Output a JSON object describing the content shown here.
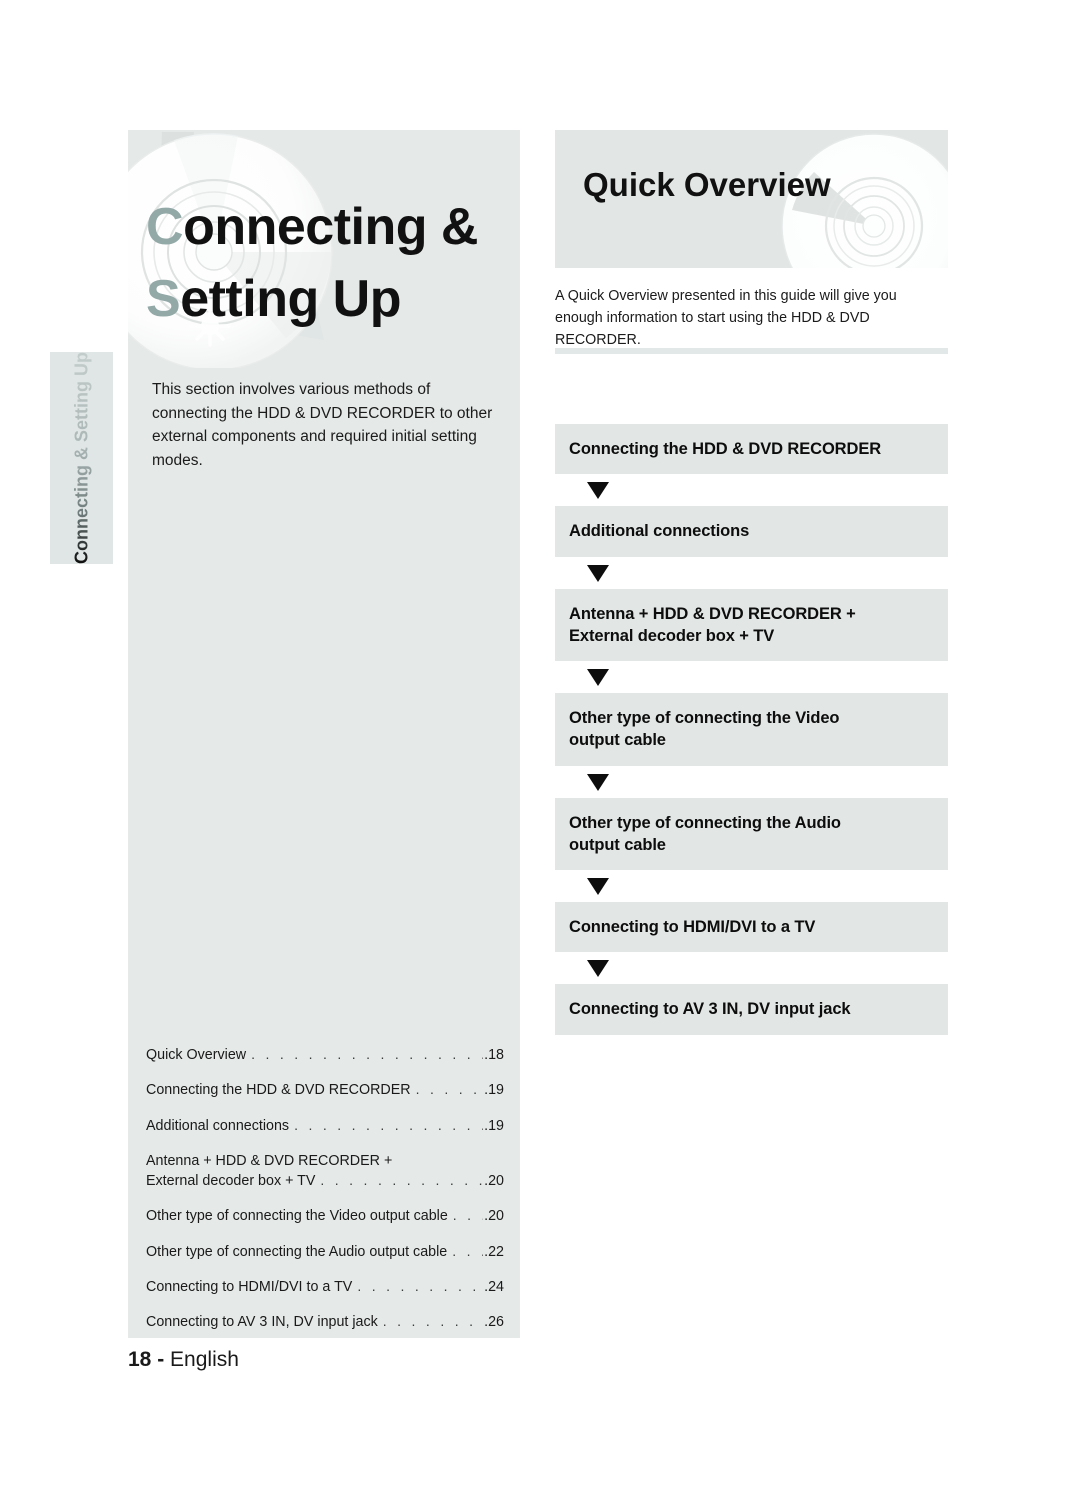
{
  "section": {
    "title_accent_1": "C",
    "title_rest_1": "onnecting &",
    "title_accent_2": "S",
    "title_rest_2": "etting Up",
    "side_tab_label": "Connecting & Setting Up",
    "intro_paragraph": "This section involves various methods of connecting the HDD & DVD RECORDER to other external components and required initial setting modes."
  },
  "quick_overview": {
    "heading": "Quick Overview",
    "paragraph": "A Quick Overview presented in this guide will give you enough information to start using the HDD & DVD RECORDER."
  },
  "flow": {
    "steps": [
      {
        "label": "Connecting the HDD & DVD RECORDER"
      },
      {
        "label": "Additional connections"
      },
      {
        "label": "Antenna + HDD & DVD RECORDER +\nExternal decoder box + TV"
      },
      {
        "label": "Other type of connecting the Video\noutput cable"
      },
      {
        "label": "Other type of connecting the Audio\noutput cable"
      },
      {
        "label": "Connecting to HDMI/DVI to a TV"
      },
      {
        "label": "Connecting to AV 3 IN, DV input jack"
      }
    ]
  },
  "toc": {
    "entries": [
      {
        "label": "Quick Overview",
        "page": "18",
        "wrap": null
      },
      {
        "label": "Connecting the HDD & DVD RECORDER",
        "page": "19",
        "wrap": null
      },
      {
        "label": "Additional connections",
        "page": "19",
        "wrap": null
      },
      {
        "label": "External decoder box + TV",
        "page": "20",
        "wrap": "Antenna + HDD & DVD RECORDER +"
      },
      {
        "label": "Other type of connecting the Video output cable",
        "page": "20",
        "wrap": null
      },
      {
        "label": "Other type of connecting the Audio output cable",
        "page": "22",
        "wrap": null
      },
      {
        "label": "Connecting to HDMI/DVI to a TV",
        "page": "24",
        "wrap": null
      },
      {
        "label": "Connecting to AV 3 IN, DV input jack",
        "page": "26",
        "wrap": null
      }
    ],
    "dot_leader": ". . . . . . . . . . . . . . . . . . . . . . . . . . . . . . . . . . . . . . . . . . . . . . . . . . . . ."
  },
  "footer": {
    "page_number": "18",
    "separator": "-",
    "language": "English"
  },
  "colors": {
    "panel_gray": "#e5e9e8",
    "box_gray": "#e2e7e6",
    "accent_letter": "#93a9a7",
    "text": "#111111"
  }
}
